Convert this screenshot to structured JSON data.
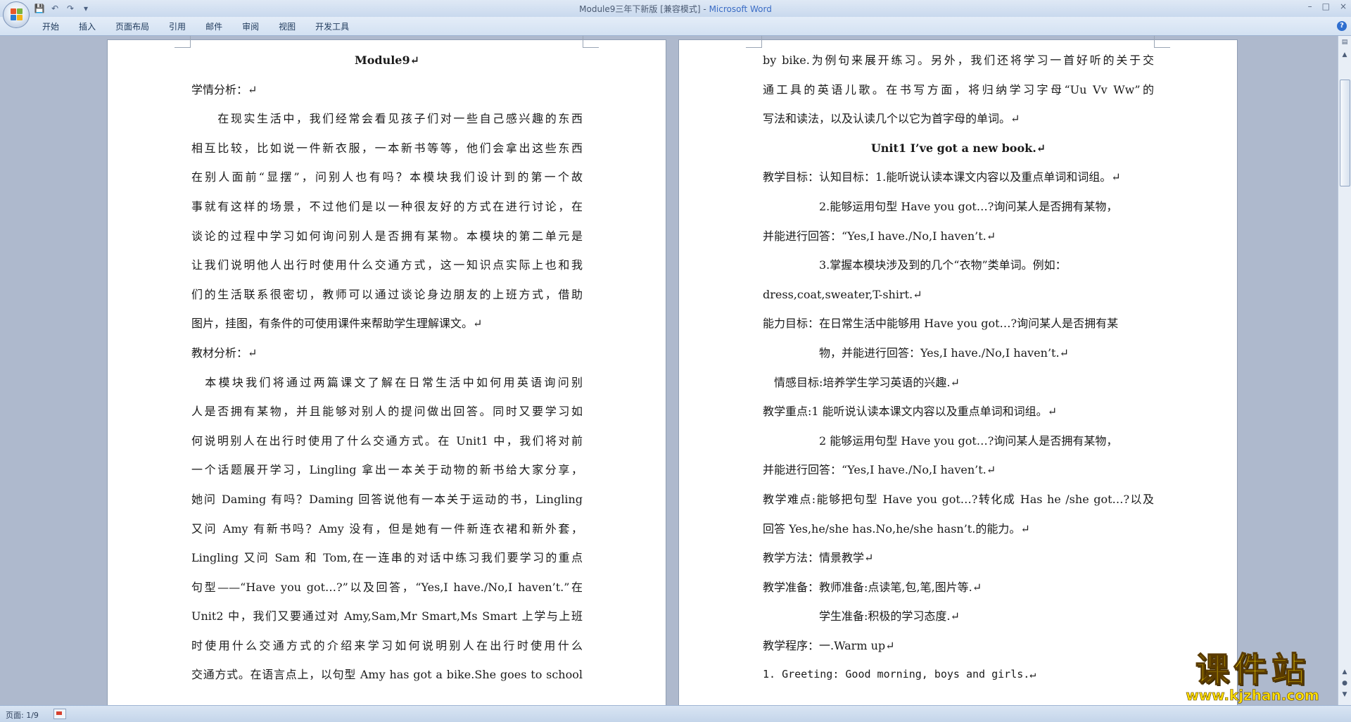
{
  "window": {
    "title": "Module9三年下新版 [兼容模式] - ",
    "app_name": "Microsoft Word",
    "controls": [
      "–",
      "□",
      "×"
    ]
  },
  "qat": {
    "save": "💾",
    "undo": "↶",
    "redo": "↷",
    "customize": "▾"
  },
  "ribbon": {
    "tabs": [
      "开始",
      "插入",
      "页面布局",
      "引用",
      "邮件",
      "审阅",
      "视图",
      "开发工具"
    ],
    "help": "?"
  },
  "left_page": {
    "lines": [
      {
        "t": "Module9↵",
        "s": "center"
      },
      {
        "t": "学情分析：↵",
        "s": "left"
      },
      {
        "t": "　　在现实生活中，我们经常会看见孩子们对一些自己感兴趣的东西",
        "s": "just"
      },
      {
        "t": "相互比较，比如说一件新衣服，一本新书等等，他们会拿出这些东西",
        "s": "just"
      },
      {
        "t": "在别人面前“显摆”，问别人也有吗？本模块我们设计到的第一个故",
        "s": "just"
      },
      {
        "t": "事就有这样的场景，不过他们是以一种很友好的方式在进行讨论，在",
        "s": "just"
      },
      {
        "t": "谈论的过程中学习如何询问别人是否拥有某物。本模块的第二单元是",
        "s": "just"
      },
      {
        "t": "让我们说明他人出行时使用什么交通方式，这一知识点实际上也和我",
        "s": "just"
      },
      {
        "t": "们的生活联系很密切，教师可以通过谈论身边朋友的上班方式，借助",
        "s": "just"
      },
      {
        "t": "图片，挂图，有条件的可使用课件来帮助学生理解课文。↵",
        "s": "left"
      },
      {
        "t": "教材分析：↵",
        "s": "left"
      },
      {
        "t": "　本模块我们将通过两篇课文了解在日常生活中如何用英语询问别",
        "s": "just"
      },
      {
        "t": "人是否拥有某物，并且能够对别人的提问做出回答。同时又要学习如",
        "s": "just"
      },
      {
        "t": "何说明别人在出行时使用了什么交通方式。在 Unit1 中，我们将对前",
        "s": "just"
      },
      {
        "t": "一个话题展开学习，Lingling 拿出一本关于动物的新书给大家分享，",
        "s": "just"
      },
      {
        "t": "她问 Daming 有吗？Daming 回答说他有一本关于运动的书，Lingling",
        "s": "just"
      },
      {
        "t": "又问 Amy 有新书吗？Amy 没有，但是她有一件新连衣裙和新外套，",
        "s": "just"
      },
      {
        "t": "Lingling 又问 Sam 和 Tom,在一连串的对话中练习我们要学习的重点",
        "s": "just"
      },
      {
        "t": "句型——“Have you got…?”以及回答，“Yes,I have./No,I haven’t.”在",
        "s": "just"
      },
      {
        "t": "Unit2 中，我们又要通过对 Amy,Sam,Mr Smart,Ms Smart 上学与上班",
        "s": "just"
      },
      {
        "t": "时使用什么交通方式的介绍来学习如何说明别人在出行时使用什么",
        "s": "just"
      },
      {
        "t": "交通方式。在语言点上，以句型 Amy has got a bike.She goes to school",
        "s": "just"
      }
    ]
  },
  "right_page": {
    "lines": [
      {
        "t": "by bike.为例句来展开练习。另外，我们还将学习一首好听的关于交",
        "s": "just"
      },
      {
        "t": "通工具的英语儿歌。在书写方面，将归纳学习字母“Uu Vv Ww”的",
        "s": "just"
      },
      {
        "t": "写法和读法，以及认读几个以它为首字母的单词。↵",
        "s": "left"
      },
      {
        "t": "Unit1 I’ve got a new book.↵",
        "s": "center"
      },
      {
        "t": "教学目标：认知目标：1.能听说认读本课文内容以及重点单词和词组。↵",
        "s": "left"
      },
      {
        "t": "　　　　　2.能够运用句型 Have you got…?询问某人是否拥有某物，",
        "s": "left"
      },
      {
        "t": "并能进行回答：“Yes,I have./No,I haven’t.↵",
        "s": "left"
      },
      {
        "t": "　　　　　3.掌握本模块涉及到的几个“衣物”类单词。例如：",
        "s": "left"
      },
      {
        "t": "dress,coat,sweater,T-shirt.↵",
        "s": "left"
      },
      {
        "t": "能力目标：在日常生活中能够用 Have you got…?询问某人是否拥有某",
        "s": "left"
      },
      {
        "t": "　　　　　物，并能进行回答：Yes,I have./No,I haven’t.↵",
        "s": "left"
      },
      {
        "t": "　情感目标:培养学生学习英语的兴趣.↵",
        "s": "left"
      },
      {
        "t": "教学重点:1 能听说认读本课文内容以及重点单词和词组。↵",
        "s": "left"
      },
      {
        "t": "　　　　　2 能够运用句型 Have you got…?询问某人是否拥有某物，",
        "s": "left"
      },
      {
        "t": "并能进行回答：“Yes,I have./No,I haven’t.↵",
        "s": "left"
      },
      {
        "t": "教学难点:能够把句型 Have you got…?转化成 Has he /she got…?以及",
        "s": "just"
      },
      {
        "t": "回答 Yes,he/she has.No,he/she hasn’t.的能力。↵",
        "s": "left"
      },
      {
        "t": "教学方法：情景教学↵",
        "s": "left"
      },
      {
        "t": "教学准备：教师准备:点读笔,包,笔,图片等.↵",
        "s": "left"
      },
      {
        "t": "　　　　　学生准备:积极的学习态度.↵",
        "s": "left"
      },
      {
        "t": "教学程序：一.Warm up↵",
        "s": "left"
      },
      {
        "t": "1. Greeting: Good morning, boys and girls.↵",
        "s": "mono"
      }
    ]
  },
  "status": {
    "page": "页面: 1/9"
  },
  "watermark": {
    "text": "课件站",
    "url": "www.kjzhan.com"
  }
}
